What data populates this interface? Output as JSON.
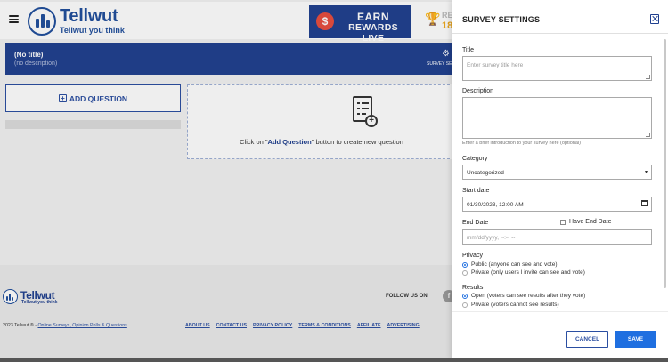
{
  "header": {
    "brand_name": "Tellwut",
    "brand_tagline": "Tellwut you think",
    "earn_line1": "EARN",
    "earn_line2": "REWARDS LIVE",
    "coin_symbol": "$",
    "rewards_label_peek": "RE",
    "rewards_value_peek": "18"
  },
  "survey": {
    "title": "(No title)",
    "description": "(no description)",
    "settings_label": "SURVEY SETTINGS"
  },
  "builder": {
    "add_question_label": "ADD QUESTION",
    "empty_prefix": "Click on \"",
    "empty_bold": "Add Question",
    "empty_suffix": "\" button to create new question"
  },
  "footer": {
    "brand_name": "Tellwut",
    "brand_tagline": "Tellwut you think",
    "follow_us": "FOLLOW US ON",
    "copyright_text": "2023 Tellwut ® - ",
    "copyright_link": "Online Surveys, Opinion Polls & Questions",
    "links": [
      "ABOUT US",
      "CONTACT US",
      "PRIVACY POLICY",
      "TERMS & CONDITIONS",
      "AFFILIATE",
      "ADVERTISING"
    ]
  },
  "drawer": {
    "heading": "SURVEY SETTINGS",
    "title_label": "Title",
    "title_placeholder": "Enter survey title here",
    "description_label": "Description",
    "description_hint": "Enter a brief introduction to your survey here (optional)",
    "category_label": "Category",
    "category_value": "Uncategorized",
    "start_date_label": "Start date",
    "start_date_value": "01/30/2023, 12:00  AM",
    "end_date_label": "End Date",
    "have_end_date_label": "Have End Date",
    "end_date_placeholder": "mm/dd/yyyy, --:-- --",
    "privacy_label": "Privacy",
    "privacy_options": [
      {
        "label": "Public (anyone can see and vote)",
        "selected": true
      },
      {
        "label": "Private (only users I invite can see and vote)",
        "selected": false
      }
    ],
    "results_label": "Results",
    "results_options": [
      {
        "label": "Open (voters can see results after they vote)",
        "selected": true
      },
      {
        "label": "Private (voters cannot see results)",
        "selected": false
      }
    ],
    "cancel_label": "CANCEL",
    "save_label": "SAVE"
  },
  "colors": {
    "brand_blue": "#1f3f8f",
    "accent_blue": "#1f6fe0",
    "coin_red": "#e84c3d",
    "trophy_gold": "#f0a91c"
  }
}
